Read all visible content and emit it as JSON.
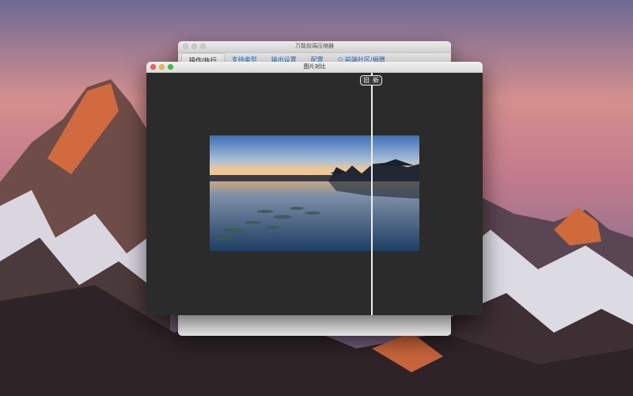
{
  "back_window": {
    "title": "万能前端压缩器",
    "tabs": [
      {
        "label": "操作/执行"
      },
      {
        "label": "支持类型"
      },
      {
        "label": "输出设置"
      },
      {
        "label": "配置"
      },
      {
        "label": "前端社区/捐赠",
        "icon": "community-icon"
      }
    ]
  },
  "front_window": {
    "title": "图片对比",
    "compare": {
      "old_label": "旧",
      "new_label": "新"
    }
  },
  "colors": {
    "accent": "#1f6fd0",
    "front_bg": "#2b2b2b"
  }
}
